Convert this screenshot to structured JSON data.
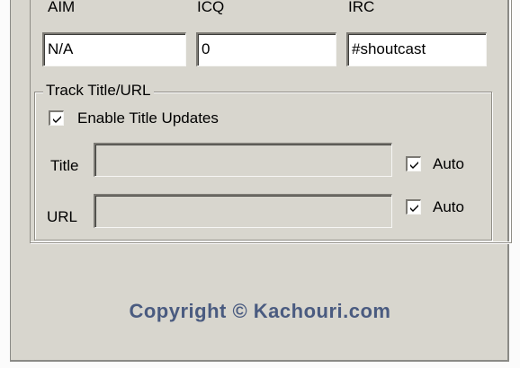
{
  "contacts": {
    "aim": {
      "label": "AIM",
      "value": "N/A"
    },
    "icq": {
      "label": "ICQ",
      "value": "0"
    },
    "irc": {
      "label": "IRC",
      "value": "#shoutcast"
    }
  },
  "track": {
    "legend": "Track Title/URL",
    "enable_updates": {
      "label": "Enable Title Updates",
      "checked": true
    },
    "title": {
      "label": "Title",
      "value": "",
      "auto_label": "Auto",
      "auto_checked": true
    },
    "url": {
      "label": "URL",
      "value": "",
      "auto_label": "Auto",
      "auto_checked": true
    }
  },
  "footer": {
    "copyright": "Copyright © Kachouri.com"
  }
}
